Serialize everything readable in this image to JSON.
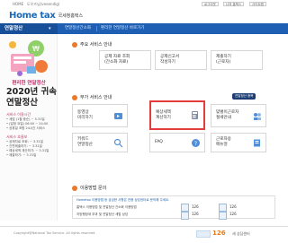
{
  "topbar": {
    "home": "HOME",
    "user": "도우즈님(veeendig)",
    "btn_logout": "로그아웃",
    "btn_mypage": "나의 홈택스",
    "btn_sitemap": "사이트맵"
  },
  "logo": {
    "brand": "Home tax",
    "sub": "국세청홈택스"
  },
  "nav": {
    "first": "연말정산",
    "items": [
      "연말정산간소화",
      "편리한 연말정산 바로가기"
    ]
  },
  "sidebar": {
    "friendly": "편리한 연말정산",
    "title_line1": "2020년 귀속",
    "title_line2": "연말정산",
    "schedule_label": "서비스 이용시간",
    "schedule": [
      "• 세법 (1월 중순) ~ 5.31일",
      "• (일정 요일) 06:00 ~ 24:00",
      "• 공휴일 포함 24시간 서비스"
    ],
    "guide_label": "서비스 흐름보",
    "guide": [
      "• 공제자료 조회: ~ 3.31일",
      "• 간편제출하기: ~ 3.31일",
      "• 예상세액 계산하기: ~ 3.31일",
      "• 제출하기: ~ 3.31일"
    ]
  },
  "main_section": {
    "title": "주요 서비스 안내",
    "items": [
      {
        "label_line1": "공제 자료 조회",
        "label_line2": "(간소화 자료)"
      },
      {
        "label_line1": "공제신고서",
        "label_line2": "작성하기"
      },
      {
        "label_line1": "제출하기",
        "label_line2": "(근로자)"
      }
    ]
  },
  "sub_section": {
    "title": "부가 서비스 안내",
    "badge": "연말정산 중복",
    "items": [
      {
        "label_line1": "동영상",
        "label_line2": "미리하기"
      },
      {
        "label_line1": "예상세액",
        "label_line2": "계산하기"
      },
      {
        "label_line1": "맞벌이근로자",
        "label_line2": "절세안내"
      },
      {
        "label_line1": "키워드",
        "label_line2": "연말정산"
      },
      {
        "label_line1": "FAQ",
        "label_line2": ""
      },
      {
        "label_line1": "근로자용",
        "label_line2": "메뉴얼"
      }
    ]
  },
  "inquiry": {
    "title": "이용방법 문의",
    "line1": "Hometax 이용방법 등 궁금한 사항은 연중 상담센터로 문의해 주세요.",
    "line2": "홈택스 이용방법 및 연말정산 간소화 이용방법",
    "line3": "지방행정세 부과 및 연말정산 세법 상담",
    "num1": "126",
    "num2": "126",
    "num3": "126",
    "num4": "126"
  },
  "footer": {
    "copy": "Copyright@National Tax Service. All rights reserved.",
    "callcenter": "126",
    "callcenter_text": "세 상담센터"
  },
  "colors": {
    "nav": "#1e5fb3",
    "accent": "#c23068",
    "dot": "#ea7a2a",
    "highlight": "#e53b3b"
  }
}
